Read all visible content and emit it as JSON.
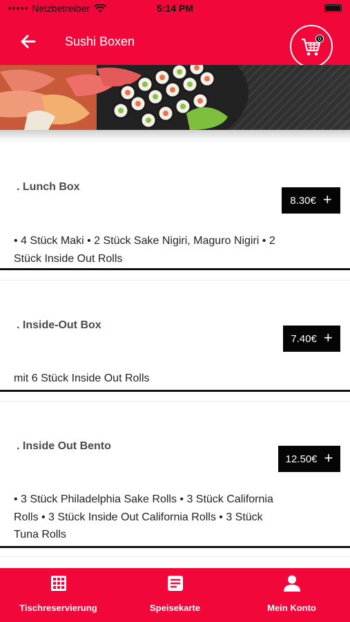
{
  "status_bar": {
    "carrier": "Netzbetreiber",
    "time": "5:14 PM"
  },
  "header": {
    "title": "Sushi Boxen",
    "cart_count": "0",
    "accent_color": "#f2073a"
  },
  "products": [
    {
      "title": ". Lunch Box",
      "price": "8.30€",
      "add_symbol": "+",
      "description": "• 4 Stück Maki • 2 Stück Sake Nigiri, Maguro Nigiri • 2 Stück Inside Out Rolls"
    },
    {
      "title": ". Inside-Out Box",
      "price": "7.40€",
      "add_symbol": "+",
      "description": "mit 6 Stück Inside Out Rolls"
    },
    {
      "title": ". Inside Out Bento",
      "price": "12.50€",
      "add_symbol": "+",
      "description": "• 3 Stück Philadelphia Sake Rolls • 3 Stück California Rolls • 3 Stück Inside Out California Rolls • 3 Stück Tuna Rolls"
    }
  ],
  "bottom_nav": [
    {
      "label": "Tischreservierung",
      "icon": "grid-icon"
    },
    {
      "label": "Speisekarte",
      "icon": "menu-list-icon"
    },
    {
      "label": "Mein Konto",
      "icon": "user-icon"
    }
  ]
}
